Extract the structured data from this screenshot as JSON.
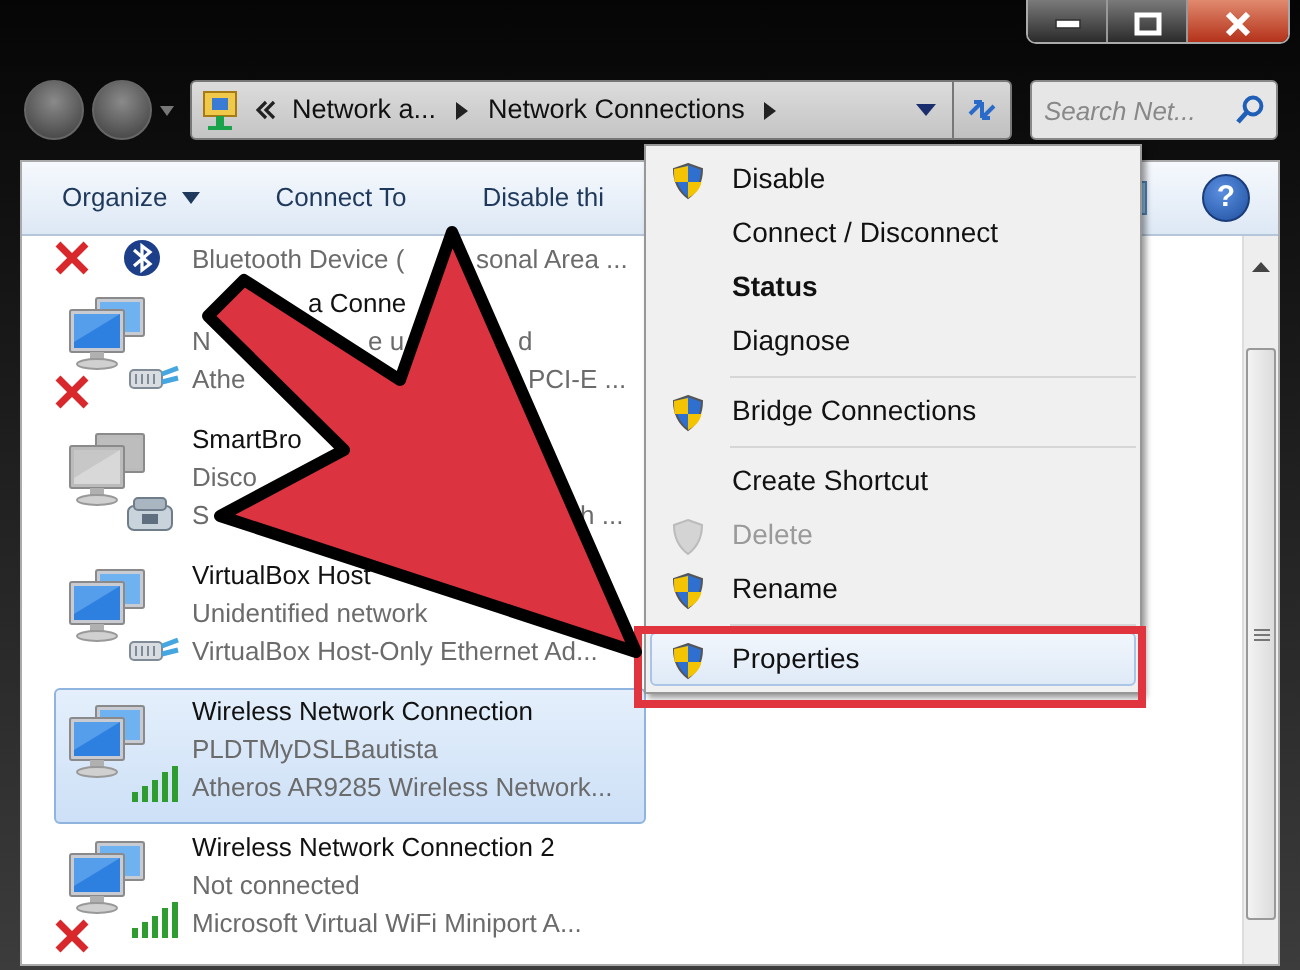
{
  "navigation": {
    "crumbs": [
      "Network a...",
      "Network Connections"
    ],
    "search": {
      "placeholder": "Search Net..."
    }
  },
  "toolbar": {
    "buttons": [
      {
        "label": "Organize",
        "dropdown": true
      },
      {
        "label": "Connect To",
        "dropdown": false
      },
      {
        "label": "Disable thi",
        "dropdown": false
      }
    ],
    "help": "?"
  },
  "connections": [
    {
      "kind": "bluetooth",
      "disconnected": true,
      "selected": false,
      "lines": [
        {
          "kind": "device",
          "parts": [
            "Bluetooth Device (",
            "sonal Area ..."
          ]
        }
      ]
    },
    {
      "kind": "ethernet",
      "disconnected": true,
      "selected": false,
      "lines": [
        {
          "kind": "name",
          "parts": [
            "a Conne"
          ]
        },
        {
          "kind": "status",
          "parts": [
            "N",
            "e u",
            "d"
          ]
        },
        {
          "kind": "device",
          "parts": [
            "Athe",
            "PCI-E ..."
          ]
        }
      ]
    },
    {
      "kind": "dialup",
      "disconnected": false,
      "selected": false,
      "lines": [
        {
          "kind": "name",
          "parts": [
            "SmartBro"
          ]
        },
        {
          "kind": "status",
          "parts": [
            "Disco"
          ]
        },
        {
          "kind": "device",
          "parts": [
            "S",
            "h ..."
          ]
        }
      ]
    },
    {
      "kind": "ethernet",
      "disconnected": false,
      "selected": false,
      "lines": [
        {
          "kind": "name",
          "parts": [
            "VirtualBox Host"
          ]
        },
        {
          "kind": "status",
          "parts": [
            "Unidentified network"
          ]
        },
        {
          "kind": "device",
          "parts": [
            "VirtualBox Host-Only Ethernet Ad..."
          ]
        }
      ]
    },
    {
      "kind": "wireless",
      "disconnected": false,
      "selected": true,
      "lines": [
        {
          "kind": "name",
          "parts": [
            "Wireless Network Connection"
          ]
        },
        {
          "kind": "status",
          "parts": [
            "PLDTMyDSLBautista"
          ]
        },
        {
          "kind": "device",
          "parts": [
            "Atheros AR9285 Wireless Network..."
          ]
        }
      ]
    },
    {
      "kind": "wireless",
      "disconnected": true,
      "selected": false,
      "lines": [
        {
          "kind": "name",
          "parts": [
            "Wireless Network Connection 2"
          ]
        },
        {
          "kind": "status",
          "parts": [
            "Not connected"
          ]
        },
        {
          "kind": "device",
          "parts": [
            "Microsoft Virtual WiFi Miniport A..."
          ]
        }
      ]
    }
  ],
  "context_menu": {
    "items": [
      {
        "kind": "item",
        "label": "Disable",
        "shield": true,
        "default": false,
        "disabled": false,
        "selected": false,
        "annotated": false
      },
      {
        "kind": "item",
        "label": "Connect / Disconnect",
        "shield": false,
        "default": false,
        "disabled": false,
        "selected": false,
        "annotated": false
      },
      {
        "kind": "item",
        "label": "Status",
        "shield": false,
        "default": true,
        "disabled": false,
        "selected": false,
        "annotated": false
      },
      {
        "kind": "item",
        "label": "Diagnose",
        "shield": false,
        "default": false,
        "disabled": false,
        "selected": false,
        "annotated": false
      },
      {
        "kind": "separator"
      },
      {
        "kind": "item",
        "label": "Bridge Connections",
        "shield": true,
        "default": false,
        "disabled": false,
        "selected": false,
        "annotated": false
      },
      {
        "kind": "separator"
      },
      {
        "kind": "item",
        "label": "Create Shortcut",
        "shield": false,
        "default": false,
        "disabled": false,
        "selected": false,
        "annotated": false
      },
      {
        "kind": "item",
        "label": "Delete",
        "shield": true,
        "default": false,
        "disabled": true,
        "selected": false,
        "annotated": false
      },
      {
        "kind": "item",
        "label": "Rename",
        "shield": true,
        "default": false,
        "disabled": false,
        "selected": false,
        "annotated": false
      },
      {
        "kind": "separator"
      },
      {
        "kind": "item",
        "label": "Properties",
        "shield": true,
        "default": false,
        "disabled": false,
        "selected": true,
        "annotated": true
      }
    ]
  },
  "pointer_arrow": true
}
